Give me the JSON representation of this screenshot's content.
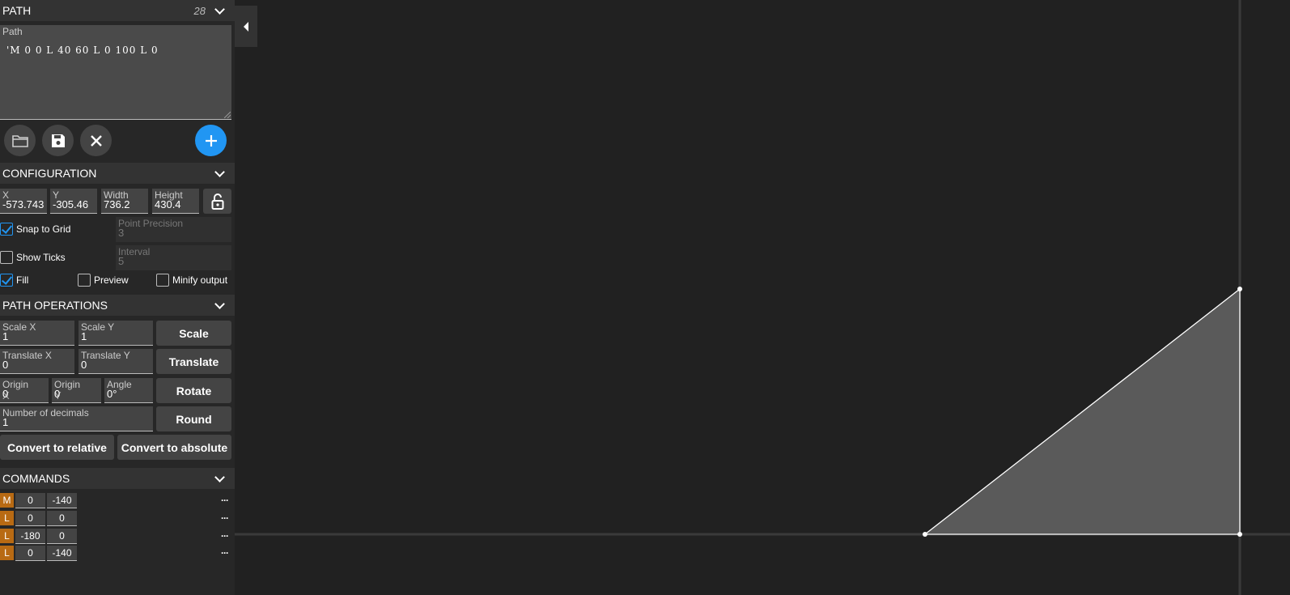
{
  "path_section": {
    "title": "PATH",
    "count": "28"
  },
  "path_field": {
    "label": "Path",
    "value": "'M 0 0 L 40 60 L 0 100 L 0"
  },
  "toolbar": {
    "open_icon": "folder-icon",
    "save_icon": "save-icon",
    "clear_icon": "close-icon",
    "add_icon": "plus-icon",
    "accent": "#2196f3"
  },
  "config_section": {
    "title": "CONFIGURATION"
  },
  "config": {
    "x": {
      "label": "X",
      "value": "-573.743"
    },
    "y": {
      "label": "Y",
      "value": "-305.46"
    },
    "width": {
      "label": "Width",
      "value": "736.2"
    },
    "height": {
      "label": "Height",
      "value": "430.4"
    },
    "snap_to_grid": {
      "label": "Snap to Grid",
      "checked": true
    },
    "point_precision": {
      "label": "Point Precision",
      "value": "3"
    },
    "show_ticks": {
      "label": "Show Ticks",
      "checked": false
    },
    "interval": {
      "label": "Interval",
      "value": "5"
    },
    "fill": {
      "label": "Fill",
      "checked": true
    },
    "preview": {
      "label": "Preview",
      "checked": false
    },
    "minify": {
      "label": "Minify output",
      "checked": false
    }
  },
  "ops_section": {
    "title": "PATH OPERATIONS"
  },
  "ops": {
    "scale_x": {
      "label": "Scale X",
      "value": "1"
    },
    "scale_y": {
      "label": "Scale Y",
      "value": "1"
    },
    "scale_button": "Scale",
    "translate_x": {
      "label": "Translate X",
      "value": "0"
    },
    "translate_y": {
      "label": "Translate Y",
      "value": "0"
    },
    "translate_button": "Translate",
    "origin_x": {
      "label": "Origin",
      "sub": "X",
      "value": "0"
    },
    "origin_y": {
      "label": "Origin",
      "sub": "Y",
      "value": "0"
    },
    "angle": {
      "label": "Angle",
      "value": "0°"
    },
    "rotate_button": "Rotate",
    "decimals": {
      "label": "Number of decimals",
      "value": "1"
    },
    "round_button": "Round",
    "relative_button": "Convert to relative",
    "absolute_button": "Convert to absolute"
  },
  "commands_section": {
    "title": "COMMANDS"
  },
  "commands": [
    {
      "type": "M",
      "x": "0",
      "y": "-140"
    },
    {
      "type": "L",
      "x": "0",
      "y": "0"
    },
    {
      "type": "L",
      "x": "-180",
      "y": "0"
    },
    {
      "type": "L",
      "x": "0",
      "y": "-140"
    }
  ],
  "more_glyph": "···",
  "canvas": {
    "shape_fill": "#5a5a5a",
    "stroke": "#ffffff",
    "axis": "#3a3a3a"
  }
}
